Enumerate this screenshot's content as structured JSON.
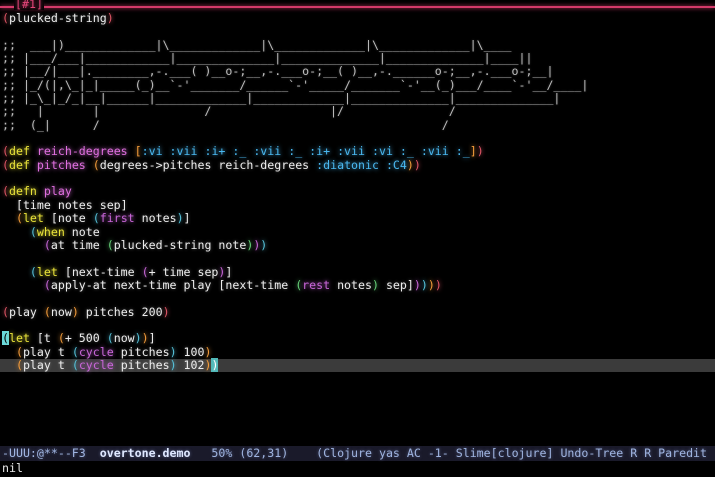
{
  "window": {
    "label": "[#1]"
  },
  "editor": {
    "lines": [
      {
        "tokens": [
          {
            "t": "(",
            "c": "p1"
          },
          {
            "t": "plucked-string",
            "c": "plain"
          },
          {
            "t": ")",
            "c": "p1"
          }
        ]
      },
      {
        "tokens": []
      },
      {
        "tokens": [
          {
            "t": ";;  ___|)_____________|\\_____________|\\_____________|\\_____________|\\____",
            "c": "ascii"
          }
        ]
      },
      {
        "tokens": [
          {
            "t": ";; |___/___|____________|______________|______________|______________|____||",
            "c": "ascii"
          }
        ]
      },
      {
        "tokens": [
          {
            "t": ";; |__/|___|.________,-.___( )__o-;__,-.___o-;__( )__,-.______o-;__,-.___o-;__|",
            "c": "ascii"
          }
        ]
      },
      {
        "tokens": [
          {
            "t": ";; |_/(|,\\_|_|_____(_)__`-'_______/______`-'_____/_______`-'__(_)___/____`-'__/____|",
            "c": "ascii"
          }
        ]
      },
      {
        "tokens": [
          {
            "t": ";; |_\\_|_/_|__|______|_____________|_____________|______________|______________|",
            "c": "ascii"
          }
        ]
      },
      {
        "tokens": [
          {
            "t": ";;   |       |               /                 |/               /",
            "c": "ascii"
          }
        ]
      },
      {
        "tokens": [
          {
            "t": ";;  (_|      /                                                 /",
            "c": "ascii"
          }
        ]
      },
      {
        "tokens": []
      },
      {
        "tokens": [
          {
            "t": "(",
            "c": "p1"
          },
          {
            "t": "def",
            "c": "def"
          },
          {
            "t": " ",
            "c": "plain"
          },
          {
            "t": "reich-degrees",
            "c": "fn-name"
          },
          {
            "t": " ",
            "c": "plain"
          },
          {
            "t": "[",
            "c": "p2"
          },
          {
            "t": ":vi :vii :i+ :_ :vii :_ :i+ :vii :vi :_ :vii :_",
            "c": "kw"
          },
          {
            "t": "]",
            "c": "p2"
          },
          {
            "t": ")",
            "c": "p1"
          }
        ]
      },
      {
        "tokens": [
          {
            "t": "(",
            "c": "p1"
          },
          {
            "t": "def",
            "c": "def"
          },
          {
            "t": " ",
            "c": "plain"
          },
          {
            "t": "pitches",
            "c": "fn-name"
          },
          {
            "t": " ",
            "c": "plain"
          },
          {
            "t": "(",
            "c": "p2"
          },
          {
            "t": "degrees->pitches reich-degrees ",
            "c": "plain"
          },
          {
            "t": ":diatonic :C4",
            "c": "kw"
          },
          {
            "t": ")",
            "c": "p2"
          },
          {
            "t": ")",
            "c": "p1"
          }
        ]
      },
      {
        "tokens": []
      },
      {
        "tokens": [
          {
            "t": "(",
            "c": "p1"
          },
          {
            "t": "defn",
            "c": "def"
          },
          {
            "t": " ",
            "c": "plain"
          },
          {
            "t": "play",
            "c": "fn-name"
          }
        ]
      },
      {
        "tokens": [
          {
            "t": "  [time notes sep]",
            "c": "plain"
          }
        ]
      },
      {
        "tokens": [
          {
            "t": "  ",
            "c": "plain"
          },
          {
            "t": "(",
            "c": "p2"
          },
          {
            "t": "let",
            "c": "def"
          },
          {
            "t": " [note ",
            "c": "plain"
          },
          {
            "t": "(",
            "c": "p3"
          },
          {
            "t": "first",
            "c": "p4"
          },
          {
            "t": " notes",
            "c": "plain"
          },
          {
            "t": ")",
            "c": "p3"
          },
          {
            "t": "]",
            "c": "plain"
          }
        ]
      },
      {
        "tokens": [
          {
            "t": "    ",
            "c": "plain"
          },
          {
            "t": "(",
            "c": "p3"
          },
          {
            "t": "when",
            "c": "def"
          },
          {
            "t": " note",
            "c": "plain"
          }
        ]
      },
      {
        "tokens": [
          {
            "t": "      ",
            "c": "plain"
          },
          {
            "t": "(",
            "c": "p4"
          },
          {
            "t": "at time ",
            "c": "plain"
          },
          {
            "t": "(",
            "c": "p5"
          },
          {
            "t": "plucked-string note",
            "c": "plain"
          },
          {
            "t": ")",
            "c": "p5"
          },
          {
            "t": ")",
            "c": "p4"
          },
          {
            "t": ")",
            "c": "p3"
          }
        ]
      },
      {
        "tokens": []
      },
      {
        "tokens": [
          {
            "t": "    ",
            "c": "plain"
          },
          {
            "t": "(",
            "c": "p3"
          },
          {
            "t": "let",
            "c": "def"
          },
          {
            "t": " [next-time ",
            "c": "plain"
          },
          {
            "t": "(",
            "c": "p4"
          },
          {
            "t": "+ time sep",
            "c": "plain"
          },
          {
            "t": ")",
            "c": "p4"
          },
          {
            "t": "]",
            "c": "plain"
          }
        ]
      },
      {
        "tokens": [
          {
            "t": "      ",
            "c": "plain"
          },
          {
            "t": "(",
            "c": "p4"
          },
          {
            "t": "apply-at next-time play [next-time ",
            "c": "plain"
          },
          {
            "t": "(",
            "c": "p5"
          },
          {
            "t": "rest",
            "c": "p4"
          },
          {
            "t": " notes",
            "c": "plain"
          },
          {
            "t": ")",
            "c": "p5"
          },
          {
            "t": " sep]",
            "c": "plain"
          },
          {
            "t": ")",
            "c": "p4"
          },
          {
            "t": ")",
            "c": "p3"
          },
          {
            "t": ")",
            "c": "p2"
          },
          {
            "t": ")",
            "c": "p1"
          }
        ]
      },
      {
        "tokens": []
      },
      {
        "tokens": [
          {
            "t": "(",
            "c": "p1"
          },
          {
            "t": "play ",
            "c": "plain"
          },
          {
            "t": "(",
            "c": "p2"
          },
          {
            "t": "now",
            "c": "plain"
          },
          {
            "t": ")",
            "c": "p2"
          },
          {
            "t": " pitches 200",
            "c": "plain"
          },
          {
            "t": ")",
            "c": "p1"
          }
        ]
      },
      {
        "tokens": []
      },
      {
        "tokens": [
          {
            "t": "(",
            "c": "cursor-box"
          },
          {
            "t": "let",
            "c": "def"
          },
          {
            "t": " [t ",
            "c": "plain"
          },
          {
            "t": "(",
            "c": "p2"
          },
          {
            "t": "+ 500 ",
            "c": "plain"
          },
          {
            "t": "(",
            "c": "p3"
          },
          {
            "t": "now",
            "c": "plain"
          },
          {
            "t": ")",
            "c": "p3"
          },
          {
            "t": ")",
            "c": "p2"
          },
          {
            "t": "]",
            "c": "plain"
          }
        ]
      },
      {
        "tokens": [
          {
            "t": "  ",
            "c": "plain"
          },
          {
            "t": "(",
            "c": "p2"
          },
          {
            "t": "play t ",
            "c": "plain"
          },
          {
            "t": "(",
            "c": "p3"
          },
          {
            "t": "cycle",
            "c": "p4"
          },
          {
            "t": " pitches",
            "c": "plain"
          },
          {
            "t": ")",
            "c": "p3"
          },
          {
            "t": " 100",
            "c": "plain"
          },
          {
            "t": ")",
            "c": "p2"
          }
        ]
      },
      {
        "hl": true,
        "tokens": [
          {
            "t": "  ",
            "c": "plain"
          },
          {
            "t": "(",
            "c": "p2"
          },
          {
            "t": "play t ",
            "c": "plain"
          },
          {
            "t": "(",
            "c": "p3"
          },
          {
            "t": "cycle",
            "c": "p4"
          },
          {
            "t": " pitches",
            "c": "plain"
          },
          {
            "t": ")",
            "c": "p3"
          },
          {
            "t": " 102",
            "c": "plain"
          },
          {
            "t": ")",
            "c": "p2"
          },
          {
            "t": ")",
            "c": "match-box"
          }
        ]
      }
    ]
  },
  "modeline": {
    "status": "-UUU:@**--F3  ",
    "buffer_name": "overtone.demo",
    "position": "   50% (62,31)",
    "modes": "    (Clojure yas AC -1- Slime[clojure] Undo-Tree R R Paredit"
  },
  "minibuffer": {
    "text": "nil"
  },
  "colors": {
    "background": "#000000",
    "topbar_line": "#d43a6a",
    "highlight_line": "#3b3b3b",
    "cursor": "#6ad8d8",
    "modeline_bg": "#1a1a2a"
  }
}
